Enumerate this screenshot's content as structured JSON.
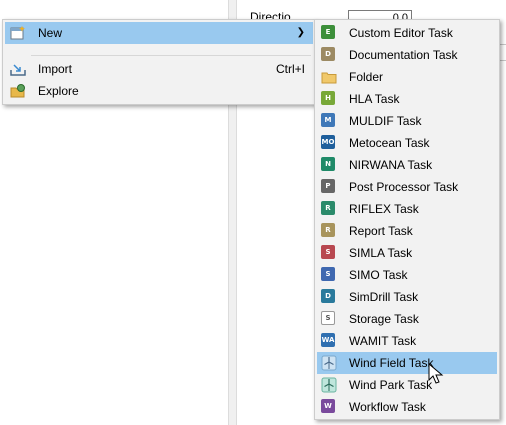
{
  "background": {
    "direction_label": "Directio",
    "direction_value": "0.0"
  },
  "context_menu": {
    "items": [
      {
        "label": "New",
        "icon": "new-task-icon",
        "has_submenu": true
      },
      {
        "label": "Import",
        "accel": "Ctrl+I",
        "icon": "import-icon"
      },
      {
        "label": "Explore",
        "icon": "explore-folder-icon"
      }
    ]
  },
  "submenu": {
    "items": [
      {
        "label": "Custom Editor Task",
        "abbr": "E",
        "color": "#3d8f3a"
      },
      {
        "label": "Documentation Task",
        "abbr": "D",
        "color": "#9c8a63"
      },
      {
        "label": "Folder",
        "abbr": "",
        "color": "#f0c86a"
      },
      {
        "label": "HLA Task",
        "abbr": "H",
        "color": "#78a838"
      },
      {
        "label": "MULDIF Task",
        "abbr": "M",
        "color": "#3f78b8"
      },
      {
        "label": "Metocean Task",
        "abbr": "MO",
        "color": "#1f5f9c"
      },
      {
        "label": "NIRWANA Task",
        "abbr": "N",
        "color": "#1f8a68"
      },
      {
        "label": "Post Processor Task",
        "abbr": "P",
        "color": "#666666"
      },
      {
        "label": "RIFLEX Task",
        "abbr": "R",
        "color": "#2a8a6a"
      },
      {
        "label": "Report Task",
        "abbr": "R",
        "color": "#a8945c"
      },
      {
        "label": "SIMLA Task",
        "abbr": "S",
        "color": "#b84850"
      },
      {
        "label": "SIMO Task",
        "abbr": "S",
        "color": "#3f68b0"
      },
      {
        "label": "SimDrill Task",
        "abbr": "D",
        "color": "#2a7a9c"
      },
      {
        "label": "Storage Task",
        "abbr": "S",
        "color": "#bdbdbd"
      },
      {
        "label": "WAMIT Task",
        "abbr": "WA",
        "color": "#2f6fb0"
      },
      {
        "label": "Wind Field Task",
        "abbr": "",
        "color": "#8fb8d8",
        "highlighted": true
      },
      {
        "label": "Wind Park Task",
        "abbr": "",
        "color": "#7fc8b8"
      },
      {
        "label": "Workflow Task",
        "abbr": "W",
        "color": "#7a4a9c"
      }
    ]
  },
  "colors": {
    "highlight": "#99c9ef",
    "menu_bg": "#f2f2f2"
  }
}
